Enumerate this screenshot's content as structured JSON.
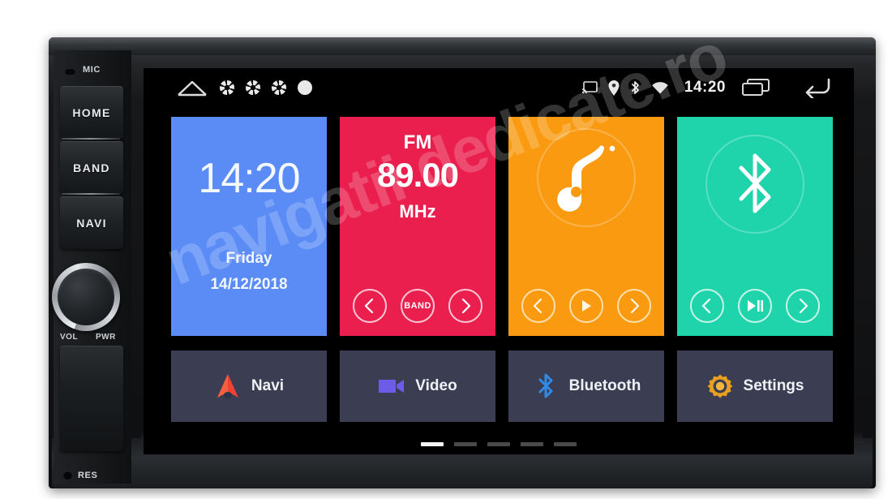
{
  "device": {
    "mic_label": "MIC",
    "reset_label": "RES",
    "buttons": [
      {
        "label": "HOME",
        "name": "home"
      },
      {
        "label": "BAND",
        "name": "band"
      },
      {
        "label": "NAVI",
        "name": "navi"
      }
    ],
    "knob": {
      "left_label": "VOL",
      "right_label": "PWR"
    }
  },
  "watermark": {
    "text": "navigatii dedicate.ro"
  },
  "statusbar": {
    "left_icons": [
      "home-icon",
      "fan-icon",
      "fan-icon",
      "fan-icon",
      "fan-solid-icon"
    ],
    "right_icons": [
      "cast-icon",
      "location-pin-icon",
      "bluetooth-icon",
      "wifi-icon"
    ],
    "clock": "14:20",
    "recents_icon": "recents-icon",
    "back_icon": "back-arrow-icon"
  },
  "tiles": {
    "clock": {
      "time": "14:20",
      "day": "Friday",
      "date": "14/12/2018",
      "color": "#5b8cf5"
    },
    "radio": {
      "band": "FM",
      "frequency": "89.00",
      "unit": "MHz",
      "color": "#ea1f4d",
      "controls": [
        {
          "name": "prev",
          "label": ""
        },
        {
          "name": "band",
          "label": "BAND"
        },
        {
          "name": "next",
          "label": ""
        }
      ]
    },
    "music": {
      "icon": "music-note-icon",
      "color": "#f99a10",
      "controls": [
        {
          "name": "prev",
          "label": ""
        },
        {
          "name": "play",
          "label": ""
        },
        {
          "name": "next",
          "label": ""
        }
      ]
    },
    "bluetooth": {
      "icon": "bluetooth-icon",
      "color": "#1fd4ab",
      "controls": [
        {
          "name": "prev",
          "label": ""
        },
        {
          "name": "play-pause",
          "label": ""
        },
        {
          "name": "next",
          "label": ""
        }
      ]
    }
  },
  "shortcuts": [
    {
      "label": "Navi",
      "icon": "navigation-arrow-icon",
      "color": "#ef4136"
    },
    {
      "label": "Video",
      "icon": "video-camera-icon",
      "color": "#6c5ce7"
    },
    {
      "label": "Bluetooth",
      "icon": "bluetooth-icon",
      "color": "#2f8ae8"
    },
    {
      "label": "Settings",
      "icon": "gear-icon",
      "color": "#e8a020"
    }
  ],
  "pager": {
    "count": 5,
    "active_index": 0
  }
}
